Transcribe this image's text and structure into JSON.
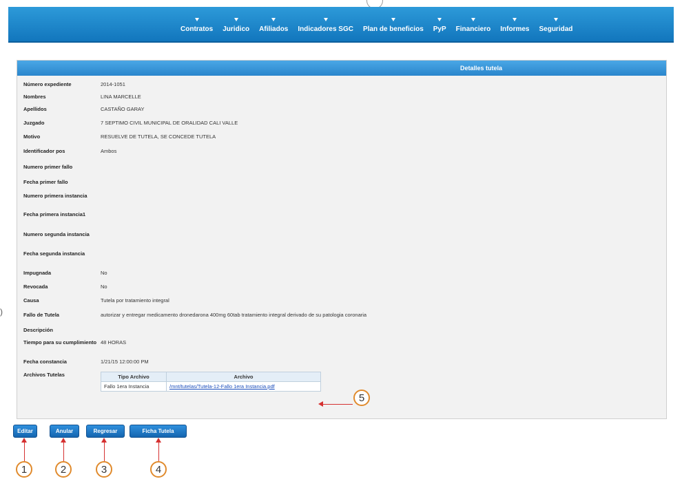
{
  "menu": [
    "Contratos",
    "Juridico",
    "Afiliados",
    "Indicadores SGC",
    "Plan de beneficios",
    "PyP",
    "Financiero",
    "Informes",
    "Seguridad"
  ],
  "panel": {
    "title": "Detalles tutela"
  },
  "fields": [
    {
      "label": "Número expediente",
      "value": "2014-1051"
    },
    {
      "label": "Nombres",
      "value": "LINA MARCELLE"
    },
    {
      "label": "Apellidos",
      "value": "CASTAÑO GARAY"
    },
    {
      "label": "Juzgado",
      "value": "7 SEPTIMO CIVIL MUNICIPAL DE ORALIDAD CALI VALLE"
    },
    {
      "label": "Motivo",
      "value": "RESUELVE DE TUTELA, SE CONCEDE TUTELA"
    },
    {
      "label": "Identificador pos",
      "value": "Ambos"
    },
    {
      "label": "Numero primer fallo",
      "value": ""
    },
    {
      "label": "Fecha primer fallo",
      "value": ""
    },
    {
      "label": "Numero primera instancia",
      "value": ""
    },
    {
      "label": "Fecha primera instancia1",
      "value": ""
    },
    {
      "label": "Numero segunda instancia",
      "value": ""
    },
    {
      "label": "Fecha segunda instancia",
      "value": ""
    },
    {
      "label": "Impugnada",
      "value": "No"
    },
    {
      "label": "Revocada",
      "value": "No"
    },
    {
      "label": "Causa",
      "value": "Tutela por tratamiento integral"
    },
    {
      "label": "Fallo de Tutela",
      "value": "autorizar y entregar medicamento dronedarona 400mg 60tab tratamiento integral derivado de su patologia coronaria"
    },
    {
      "label": "Descripción",
      "value": ""
    },
    {
      "label": "Tiempo para su cumplimiento",
      "value": "48 HORAS"
    },
    {
      "label": "Fecha constancia",
      "value": "1/21/15 12:00:00 PM"
    }
  ],
  "files": {
    "label": "Archivos Tutelas",
    "headers": [
      "Tipo Archivo",
      "Archivo"
    ],
    "rows": [
      {
        "tipo": "Fallo 1era Instancia",
        "archivo": "/mnt/tutelas/Tutela-12-Fallo 1era Instancia.pdf"
      }
    ]
  },
  "buttons": {
    "editar": "Editar",
    "anular": "Anular",
    "regresar": "Regresar",
    "ficha": "Ficha Tutela"
  },
  "callouts": [
    "1",
    "2",
    "3",
    "4",
    "5"
  ]
}
